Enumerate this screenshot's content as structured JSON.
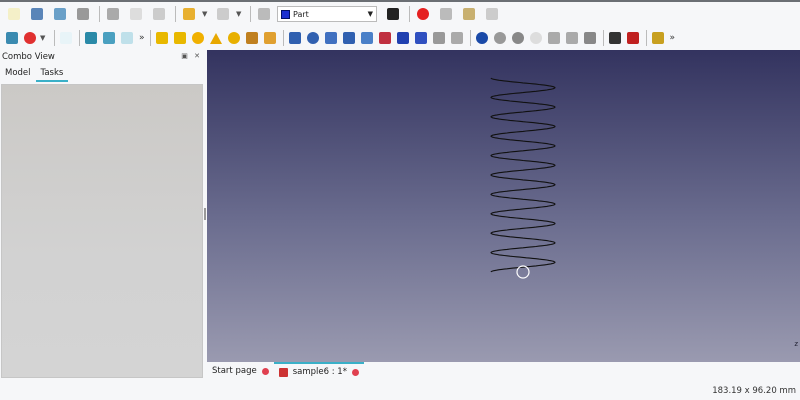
{
  "toolbar1": [
    {
      "n": "new-document-icon",
      "c": "#f4f0c8"
    },
    {
      "n": "open-icon",
      "c": "#5a85b8"
    },
    {
      "n": "save-icon",
      "c": "#6aa0c8"
    },
    {
      "n": "print-icon",
      "c": "#999"
    },
    "sep",
    {
      "n": "cut-icon",
      "c": "#aaa"
    },
    {
      "n": "copy-icon",
      "c": "#ddd"
    },
    {
      "n": "paste-icon",
      "c": "#ccc"
    },
    "sep",
    {
      "n": "undo-icon",
      "c": "#e8b030"
    },
    "dd",
    {
      "n": "redo-icon",
      "c": "#ccc"
    },
    "dd",
    "sep",
    {
      "n": "refresh-icon",
      "c": "#bbb"
    },
    "wb",
    {
      "n": "whats-this-icon",
      "c": "#222"
    },
    "sep",
    {
      "n": "record-macro-icon",
      "c": "#e52020",
      "r": 1
    },
    {
      "n": "stop-macro-icon",
      "c": "#bbb"
    },
    {
      "n": "macros-icon",
      "c": "#c8b070"
    },
    {
      "n": "run-macro-icon",
      "c": "#ccc"
    }
  ],
  "toolbar2": [
    {
      "n": "fit-all-icon",
      "c": "#3a8ab0"
    },
    {
      "n": "draw-style-icon",
      "c": "#e03030",
      "r": 1
    },
    "dd",
    "sep",
    {
      "n": "isometric-view-icon",
      "c": "#e8f4f8"
    },
    "sep",
    {
      "n": "front-view-icon",
      "c": "#2a8aa8"
    },
    {
      "n": "top-view-icon",
      "c": "#4aa0c0"
    },
    {
      "n": "right-view-icon",
      "c": "#bfe0ea"
    },
    "more",
    "sep",
    {
      "n": "box-icon",
      "c": "#e8b800"
    },
    {
      "n": "cylinder-icon",
      "c": "#e8b800"
    },
    {
      "n": "sphere-icon",
      "c": "#f0b000",
      "r": 1
    },
    {
      "n": "cone-icon",
      "c": "#e8a800",
      "t": 1
    },
    {
      "n": "torus-icon",
      "c": "#e8b000",
      "r": 1
    },
    {
      "n": "primitives-icon",
      "c": "#c08020"
    },
    {
      "n": "shape-builder-icon",
      "c": "#e0a030"
    },
    "sep",
    {
      "n": "extrude-icon",
      "c": "#3060b0"
    },
    {
      "n": "revolve-icon",
      "c": "#3060b0",
      "r": 1
    },
    {
      "n": "mirror-icon",
      "c": "#4070c0"
    },
    {
      "n": "fillet-icon",
      "c": "#3060b0"
    },
    {
      "n": "chamfer-icon",
      "c": "#4a80c8"
    },
    {
      "n": "make-face-icon",
      "c": "#c03040"
    },
    {
      "n": "ruled-surface-icon",
      "c": "#2040b0"
    },
    {
      "n": "loft-icon",
      "c": "#3050c0"
    },
    {
      "n": "sweep-icon",
      "c": "#999"
    },
    {
      "n": "section-icon",
      "c": "#aaa"
    },
    "sep",
    {
      "n": "boolean-icon",
      "c": "#1a4aa8",
      "r": 1
    },
    {
      "n": "cut-shape-icon",
      "c": "#999",
      "r": 1
    },
    {
      "n": "fuse-icon",
      "c": "#888",
      "r": 1
    },
    {
      "n": "common-icon",
      "c": "#ddd",
      "r": 1
    },
    {
      "n": "section-cross-icon",
      "c": "#aaa"
    },
    {
      "n": "compound-icon",
      "c": "#aaa"
    },
    {
      "n": "split-icon",
      "c": "#888"
    },
    "sep",
    {
      "n": "check-geometry-icon",
      "c": "#333"
    },
    {
      "n": "defeaturing-icon",
      "c": "#c02020"
    },
    "sep",
    {
      "n": "measure-icon",
      "c": "#c8a020"
    },
    "more"
  ],
  "workbench": {
    "label": "Part"
  },
  "combo_view": {
    "title": "Combo View",
    "tabs": [
      "Model",
      "Tasks"
    ],
    "buttons": "▣ ✕"
  },
  "viewport": {
    "background_top": "#33335f",
    "background_bottom": "#9a9ab0",
    "helix_turns": 10,
    "axis_label": "z"
  },
  "doc_tabs": [
    {
      "label": "Start page"
    },
    {
      "label": "sample6 : 1*"
    }
  ],
  "status": {
    "dimensions": "183.19 x 96.20 mm"
  }
}
